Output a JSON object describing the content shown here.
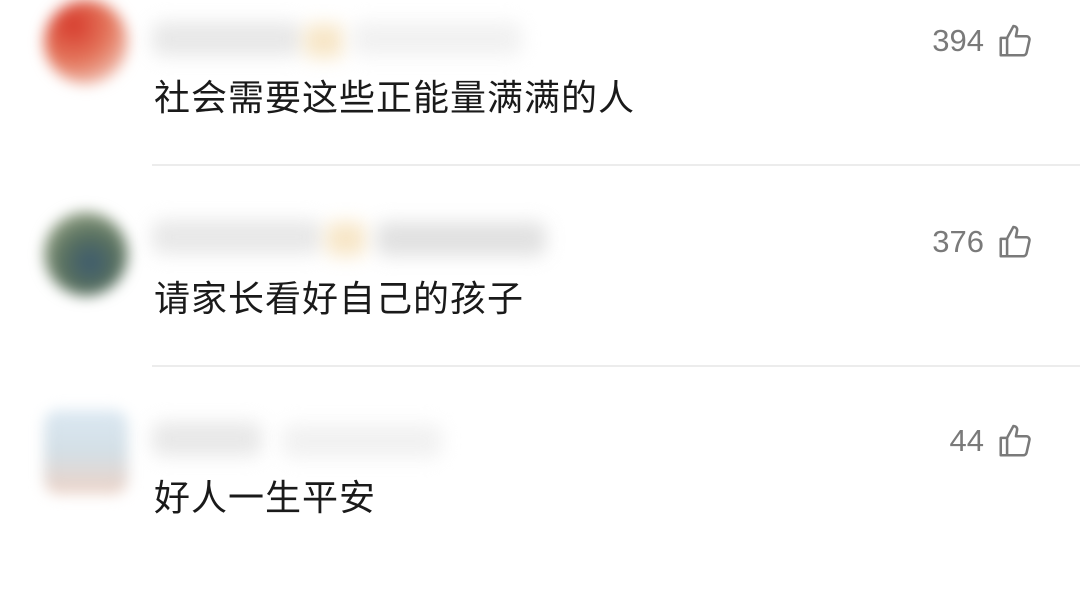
{
  "comments": [
    {
      "text": "社会需要这些正能量满满的人",
      "likes": "394",
      "like_icon": "thumbs-up-icon"
    },
    {
      "text": "请家长看好自己的孩子",
      "likes": "376",
      "like_icon": "thumbs-up-icon"
    },
    {
      "text": "好人一生平安",
      "likes": "44",
      "like_icon": "thumbs-up-icon"
    }
  ],
  "colors": {
    "text": "#1a1a1a",
    "like_count": "#7a7a7a",
    "divider": "#ececec"
  }
}
